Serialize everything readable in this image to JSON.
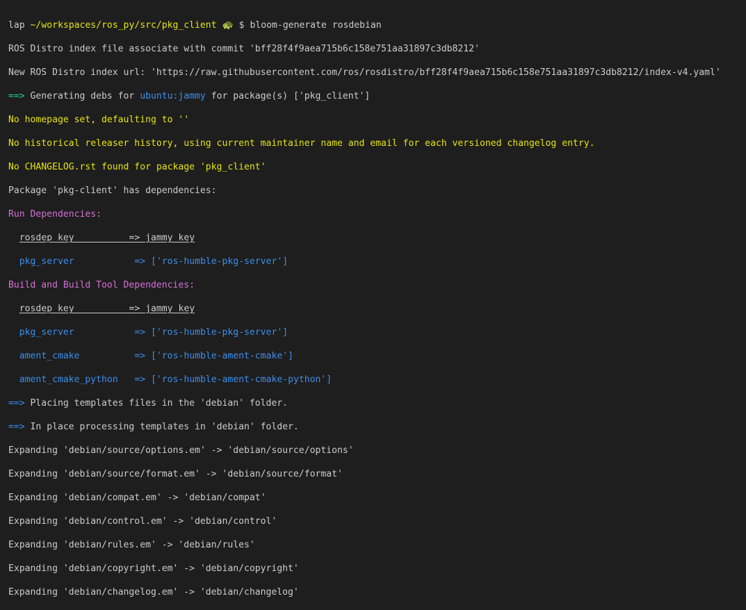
{
  "colors": {
    "background": "#1e1e1e",
    "default": "#cccccc",
    "yellow": "#e5e510",
    "green": "#23d18b",
    "blue": "#3b8eea",
    "magenta": "#d670d6"
  },
  "prompt": {
    "user": "lap",
    "path": "~/workspaces/ros_py/src/pkg_client",
    "icon": "turtle-icon",
    "icon_glyph": "🐢",
    "symbol": "$",
    "command": "bloom-generate rosdebian"
  },
  "lines": {
    "l1": "ROS Distro index file associate with commit 'bff28f4f9aea715b6c158e751aa31897c3db8212'",
    "l2": "New ROS Distro index url: 'https://raw.githubusercontent.com/ros/rosdistro/bff28f4f9aea715b6c158e751aa31897c3db8212/index-v4.yaml'",
    "l3_arrow": "==>",
    "l3_a": " Generating debs for ",
    "l3_distro": "ubuntu:jammy",
    "l3_b": " for package(s) ['pkg_client']",
    "l4": "No homepage set, defaulting to ''",
    "l5": "No historical releaser history, using current maintainer name and email for each versioned changelog entry.",
    "l6": "No CHANGELOG.rst found for package 'pkg_client'",
    "l7": "Package 'pkg-client' has dependencies:",
    "run_header": "Run Dependencies:",
    "run_key_header": "rosdep key",
    "run_arrow_header": "=>",
    "run_val_header": "jammy key",
    "run_dep1_key": "pkg_server",
    "run_dep1_arrow": "=>",
    "run_dep1_val": "['ros-humble-pkg-server']",
    "build_header": "Build and Build Tool Dependencies:",
    "build_key_header": "rosdep key",
    "build_arrow_header": "=>",
    "build_val_header": "jammy key",
    "build_dep1_key": "pkg_server",
    "build_dep1_arrow": "=>",
    "build_dep1_val": "['ros-humble-pkg-server']",
    "build_dep2_key": "ament_cmake",
    "build_dep2_arrow": "=>",
    "build_dep2_val": "['ros-humble-ament-cmake']",
    "build_dep3_key": "ament_cmake_python",
    "build_dep3_arrow": "=>",
    "build_dep3_val": "['ros-humble-ament-cmake-python']",
    "place_arrow": "==>",
    "place_text": " Placing templates files in the 'debian' folder.",
    "proc_arrow": "==>",
    "proc_text": " In place processing templates in 'debian' folder.",
    "exp1": "Expanding 'debian/source/options.em' -> 'debian/source/options'",
    "exp2": "Expanding 'debian/source/format.em' -> 'debian/source/format'",
    "exp3": "Expanding 'debian/compat.em' -> 'debian/compat'",
    "exp4": "Expanding 'debian/control.em' -> 'debian/control'",
    "exp5": "Expanding 'debian/rules.em' -> 'debian/rules'",
    "exp6": "Expanding 'debian/copyright.em' -> 'debian/copyright'",
    "exp7": "Expanding 'debian/changelog.em' -> 'debian/changelog'"
  }
}
